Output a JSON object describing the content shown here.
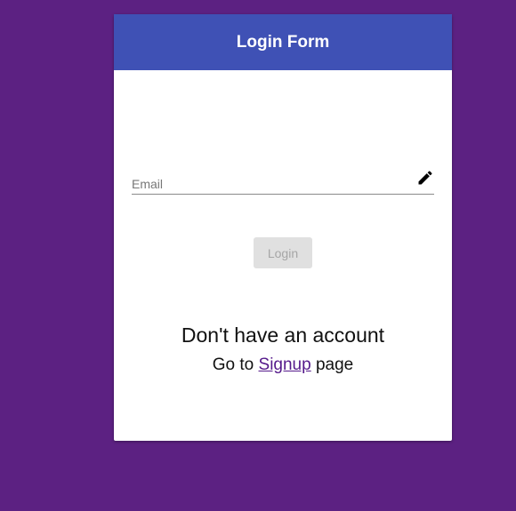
{
  "header": {
    "title": "Login Form"
  },
  "form": {
    "email_placeholder": "Email",
    "email_value": "",
    "edit_icon": "pencil-icon",
    "login_label": "Login"
  },
  "footer": {
    "no_account_text": "Don't have an account",
    "goto_prefix": "Go to",
    "signup_link": "Signup",
    "goto_suffix": "page"
  },
  "colors": {
    "background": "#5c2182",
    "header": "#3f51b5",
    "link": "#551a8b",
    "button_disabled_bg": "#e0e0e0",
    "button_disabled_text": "#a6a6a6"
  }
}
